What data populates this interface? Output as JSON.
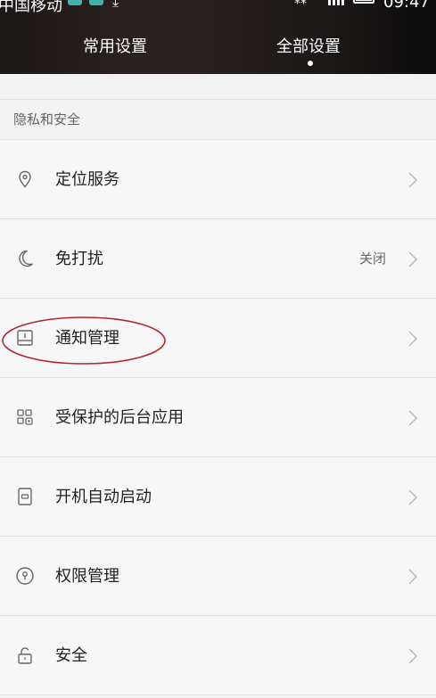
{
  "status_bar": {
    "carrier": "中国移动",
    "time": "09:47",
    "icons": [
      "notification-icon",
      "notification-icon",
      "download-icon",
      "wifi-icon",
      "signal-icon",
      "battery-icon"
    ]
  },
  "tabs": [
    {
      "label": "常用设置",
      "selected": false
    },
    {
      "label": "全部设置",
      "selected": true
    }
  ],
  "section": {
    "title": "隐私和安全"
  },
  "items": [
    {
      "label": "定位服务",
      "value": "",
      "icon": "location-pin-icon"
    },
    {
      "label": "免打扰",
      "value": "关闭",
      "icon": "moon-icon"
    },
    {
      "label": "通知管理",
      "value": "",
      "icon": "notification-manage-icon"
    },
    {
      "label": "受保护的后台应用",
      "value": "",
      "icon": "protected-apps-icon"
    },
    {
      "label": "开机自动启动",
      "value": "",
      "icon": "autostart-icon"
    },
    {
      "label": "权限管理",
      "value": "",
      "icon": "permission-lock-icon"
    },
    {
      "label": "安全",
      "value": "",
      "icon": "padlock-icon"
    }
  ],
  "colors": {
    "header_bg": "#1c1817",
    "list_bg": "#f7f7f7",
    "annotation": "#b3262d"
  }
}
